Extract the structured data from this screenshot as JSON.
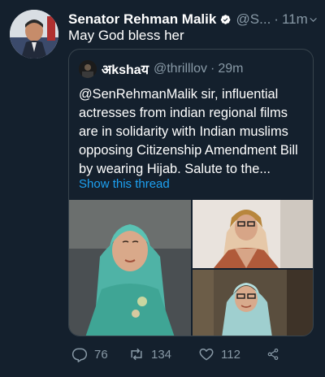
{
  "tweet": {
    "author_name": "Senator Rehman Malik",
    "author_handle": "@S...",
    "time": "11m",
    "text": "May God bless her"
  },
  "quoted_tweet": {
    "author_name": "अkshaय",
    "author_handle": "@thrilllov",
    "time": "29m",
    "text": "@SenRehmanMalik sir, influential actresses from indian regional films are in solidarity with Indian muslims opposing Citizenship Amendment Bill by wearing Hijab. Salute to the...",
    "show_thread_label": "Show this thread"
  },
  "actions": {
    "reply_count": "76",
    "retweet_count": "134",
    "like_count": "112"
  },
  "icons": {
    "verified": "verified-badge-icon",
    "menu": "chevron-down-icon",
    "reply": "reply-icon",
    "retweet": "retweet-icon",
    "like": "heart-icon",
    "share": "share-icon"
  },
  "colors": {
    "background": "#14202d",
    "secondary_text": "#8899a6",
    "link": "#1da1f2",
    "border": "#38444d"
  }
}
